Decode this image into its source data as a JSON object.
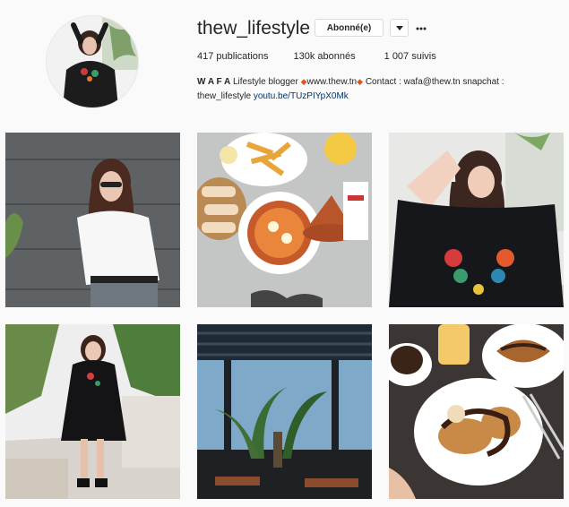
{
  "profile": {
    "username": "thew_lifestyle",
    "follow_button_label": "Abonné(e)",
    "stats": {
      "posts": "417 publications",
      "followers": "130k abonnés",
      "following": "1 007 suivis"
    },
    "bio": {
      "name": "W A F A",
      "text1": "Lifestyle blogger",
      "website": "www.thew.tn",
      "contact": "Contact : wafa@thew.tn snapchat :",
      "text2": "thew_lifestyle",
      "link": "youtu.be/TUzPIYpX0Mk"
    }
  },
  "icons": {
    "dropdown": "caret-down-icon",
    "more": "ellipsis-icon",
    "diamond": "diamond-icon"
  },
  "colors": {
    "accent_link": "#003569",
    "diamond": "#e1561b",
    "border": "#dbdbdb",
    "background": "#fafafa"
  },
  "grid": {
    "posts": [
      {
        "subject": "woman in white shirt and sunglasses against grey wall"
      },
      {
        "subject": "fries, bread and shakshuka on marble table"
      },
      {
        "subject": "woman in black embroidered blouse"
      },
      {
        "subject": "woman in black dress among palm plants"
      },
      {
        "subject": "rooftop terrace with palm tree"
      },
      {
        "subject": "waffles with chocolate and coffee"
      }
    ]
  }
}
